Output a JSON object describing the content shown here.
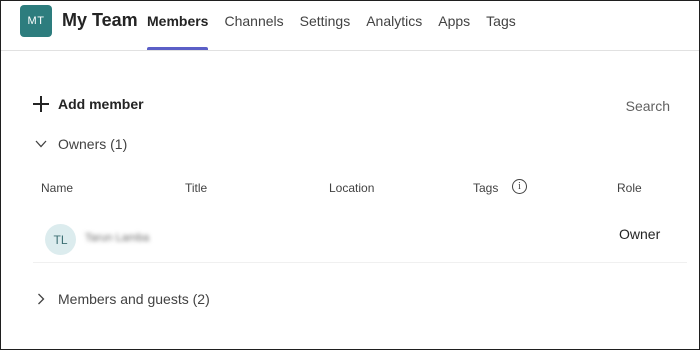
{
  "team": {
    "initials": "MT",
    "name": "My Team",
    "avatar_color": "#2d7d7e"
  },
  "tabs": [
    {
      "label": "Members",
      "active": true
    },
    {
      "label": "Channels",
      "active": false
    },
    {
      "label": "Settings",
      "active": false
    },
    {
      "label": "Analytics",
      "active": false
    },
    {
      "label": "Apps",
      "active": false
    },
    {
      "label": "Tags",
      "active": false
    }
  ],
  "accent_color": "#5b5fc7",
  "toolbar": {
    "add_member_label": "Add member",
    "add_member_icon": "plus-icon",
    "search_placeholder": "Search"
  },
  "owners_section": {
    "label": "Owners (1)",
    "expanded": true,
    "icon": "chevron-down-icon"
  },
  "columns": {
    "name": "Name",
    "title": "Title",
    "location": "Location",
    "tags": "Tags",
    "role": "Role"
  },
  "members": [
    {
      "initials": "TL",
      "name": "Tarun Lamba",
      "title": "",
      "location": "",
      "role": "Owner"
    }
  ],
  "guests_section": {
    "label": "Members and guests (2)",
    "expanded": false,
    "icon": "chevron-right-icon"
  }
}
